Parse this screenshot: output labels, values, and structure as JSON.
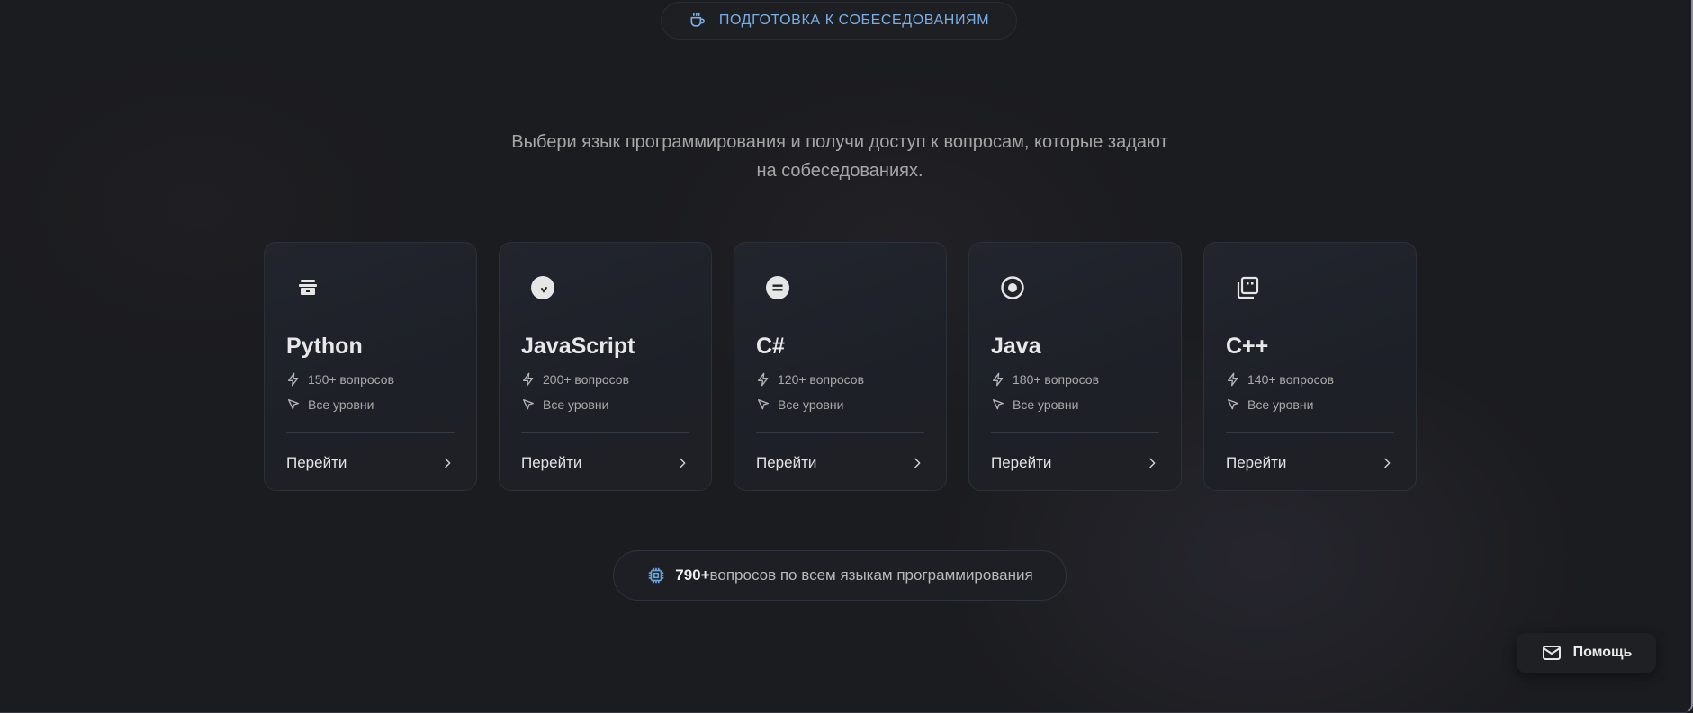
{
  "header": {
    "badge_label": "ПОДГОТОВКА К СОБЕСЕДОВАНИЯМ",
    "badge_icon": "coffee-cup-icon",
    "accent": "#7aaee6"
  },
  "intro": {
    "subtitle": "Выбери язык программирования и получи доступ к вопросам, которые задают на собеседованиях."
  },
  "languages": [
    {
      "title": "Python",
      "icon": "python-icon",
      "questions": "150+ вопросов",
      "level": "Все уровни",
      "action": "Перейти"
    },
    {
      "title": "JavaScript",
      "icon": "javascript-icon",
      "questions": "200+ вопросов",
      "level": "Все уровни",
      "action": "Перейти"
    },
    {
      "title": "C#",
      "icon": "csharp-icon",
      "questions": "120+ вопросов",
      "level": "Все уровни",
      "action": "Перейти"
    },
    {
      "title": "Java",
      "icon": "java-icon",
      "questions": "180+ вопросов",
      "level": "Все уровни",
      "action": "Перейти"
    },
    {
      "title": "C++",
      "icon": "cpp-icon",
      "questions": "140+ вопросов",
      "level": "Все уровни",
      "action": "Перейти"
    }
  ],
  "stats": {
    "count": "790+",
    "text": "вопросов по всем языкам программирования",
    "icon": "cpu-chip-icon"
  },
  "help": {
    "label": "Помощь",
    "icon": "mail-icon"
  }
}
